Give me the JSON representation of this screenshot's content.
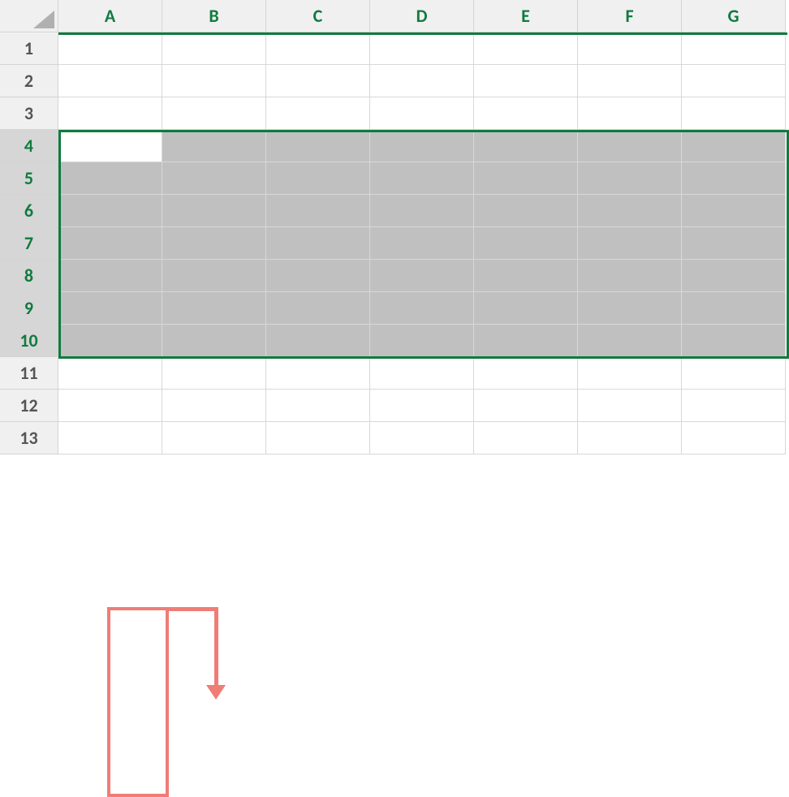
{
  "columns": [
    "A",
    "B",
    "C",
    "D",
    "E",
    "F",
    "G"
  ],
  "rows": [
    "1",
    "2",
    "3",
    "4",
    "5",
    "6",
    "7",
    "8",
    "9",
    "10",
    "11",
    "12",
    "13"
  ],
  "selection": {
    "startRow": 4,
    "endRow": 10,
    "activeCell": "A4"
  },
  "colors": {
    "selectionBorder": "#0F7B3E",
    "annotation": "#EF7D76"
  }
}
